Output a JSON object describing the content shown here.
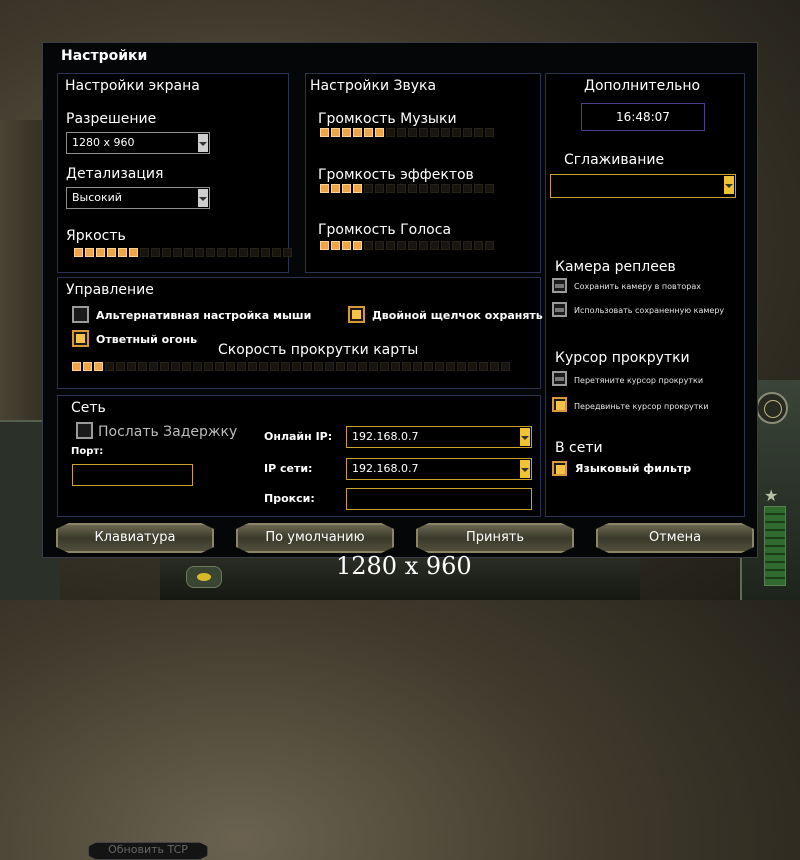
{
  "window_title": "Настройки",
  "screen": {
    "title": "Настройки экрана",
    "resolution_label": "Разрешение",
    "resolution_value": "1280 x 960",
    "detail_label": "Детализация",
    "detail_value": "Высокий",
    "brightness_label": "Яркость",
    "brightness_level": 6,
    "brightness_total": 20
  },
  "sound": {
    "title": "Настройки Звука",
    "music_label": "Громкость Музыки",
    "music_level": 6,
    "effects_label": "Громкость эффектов",
    "effects_level": 4,
    "voice_label": "Громкость Голоса",
    "voice_level": 4,
    "total": 16
  },
  "extra": {
    "title": "Дополнительно",
    "clock": "16:48:07",
    "antialias_label": "Сглаживание",
    "antialias_value": "",
    "replay_camera_title": "Камера реплеев",
    "save_camera_label": "Сохранить камеру в повторах",
    "use_saved_camera_label": "Использовать сохраненную камеру",
    "scroll_cursor_title": "Курсор прокрутки",
    "drag_cursor_label": "Перетяните курсор прокрутки",
    "move_cursor_label": "Передвиньте курсор прокрутки",
    "online_title": "В сети",
    "language_filter_label": "Языковый фильтр"
  },
  "control": {
    "title": "Управление",
    "alt_mouse_label": "Альтернативная настройка мыши",
    "double_click_label": "Двойной щелчок охранять",
    "return_fire_label": "Ответный огонь",
    "scroll_speed_label": "Скорость прокрутки карты",
    "scroll_speed_level": 3,
    "scroll_speed_total": 40
  },
  "network": {
    "title": "Сеть",
    "send_delay_label": "Послать Задержку",
    "port_label": "Порт:",
    "port_value": "",
    "update_tcp_label": "Обновить TCP",
    "online_ip_label": "Онлайн IP:",
    "online_ip_value": "192.168.0.7",
    "lan_ip_label": "IP сети:",
    "lan_ip_value": "192.168.0.7",
    "proxy_label": "Прокси:",
    "proxy_value": ""
  },
  "buttons": {
    "keyboard": "Клавиатура",
    "defaults": "По умолчанию",
    "accept": "Принять",
    "cancel": "Отмена"
  },
  "overlay_resolution": "1280 x 960",
  "colors": {
    "accent": "#f0a448",
    "gold_border": "#caa22c",
    "panel_border": "#2e3252"
  }
}
